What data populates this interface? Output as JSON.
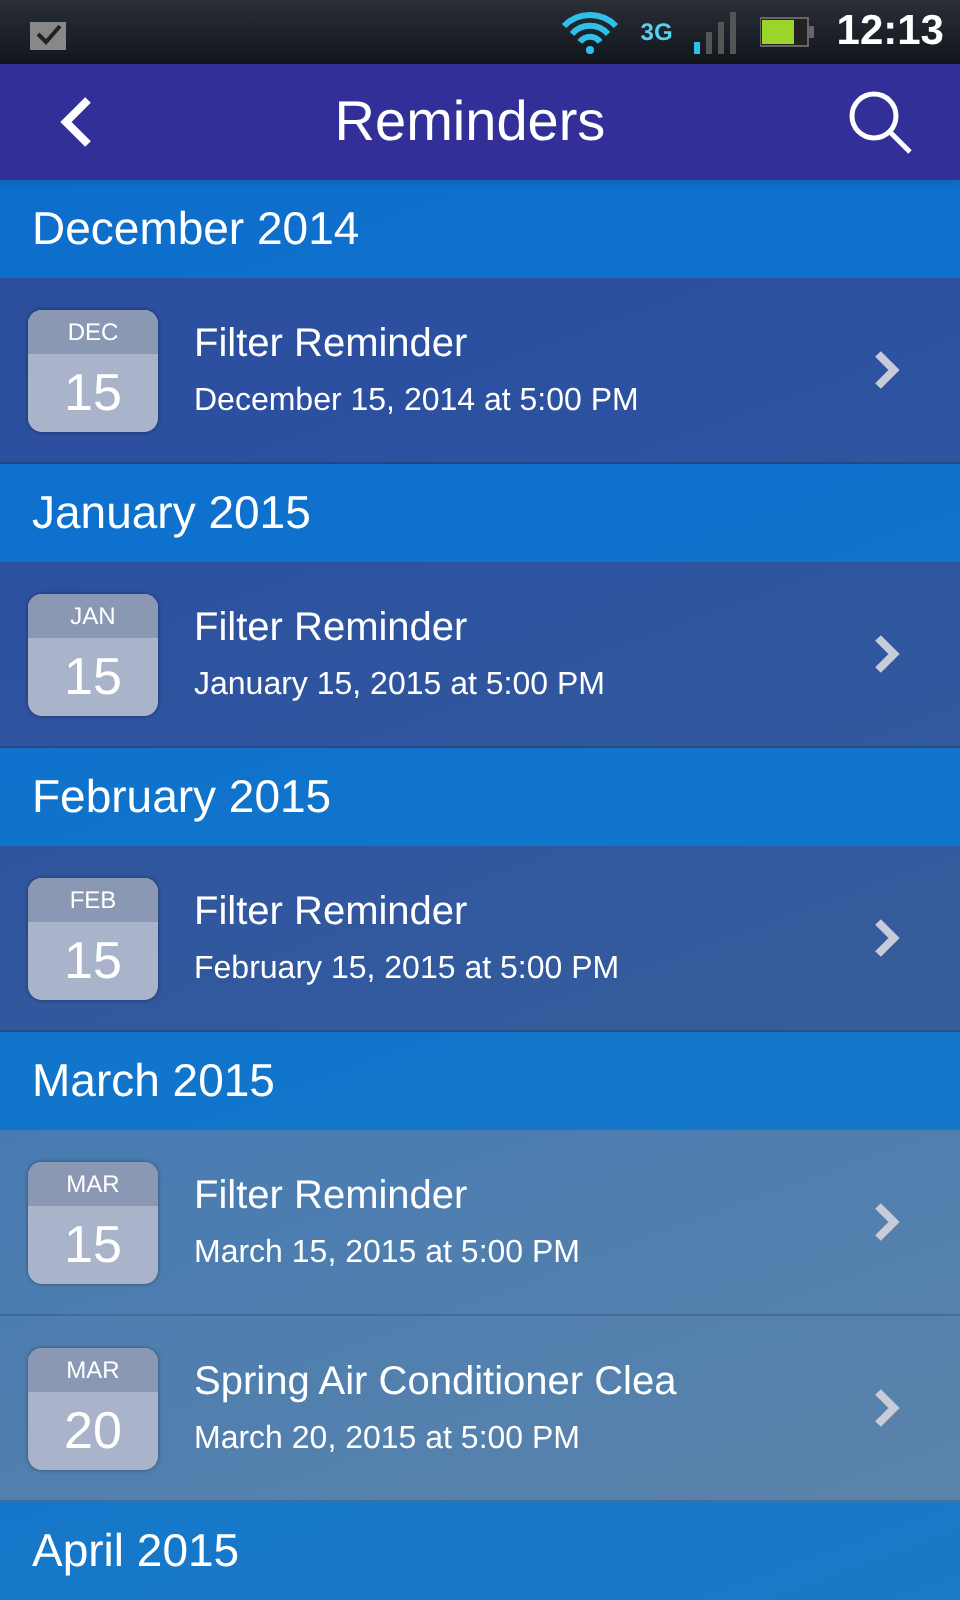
{
  "status_bar": {
    "time": "12:13",
    "network": "3G"
  },
  "app_bar": {
    "title": "Reminders"
  },
  "sections": [
    {
      "header": "December 2014",
      "reminders": [
        {
          "month": "DEC",
          "day": "15",
          "title": "Filter Reminder",
          "when": "December 15, 2014 at 5:00 PM"
        }
      ]
    },
    {
      "header": "January 2015",
      "reminders": [
        {
          "month": "JAN",
          "day": "15",
          "title": "Filter Reminder",
          "when": "January 15, 2015 at 5:00 PM"
        }
      ]
    },
    {
      "header": "February 2015",
      "reminders": [
        {
          "month": "FEB",
          "day": "15",
          "title": "Filter Reminder",
          "when": "February 15, 2015 at 5:00 PM"
        }
      ]
    },
    {
      "header": "March 2015",
      "reminders": [
        {
          "month": "MAR",
          "day": "15",
          "title": "Filter Reminder",
          "when": "March 15, 2015 at 5:00 PM"
        },
        {
          "month": "MAR",
          "day": "20",
          "title": "Spring Air Conditioner Clea",
          "when": "March 20, 2015 at 5:00 PM"
        }
      ]
    },
    {
      "header": "April 2015"
    }
  ]
}
